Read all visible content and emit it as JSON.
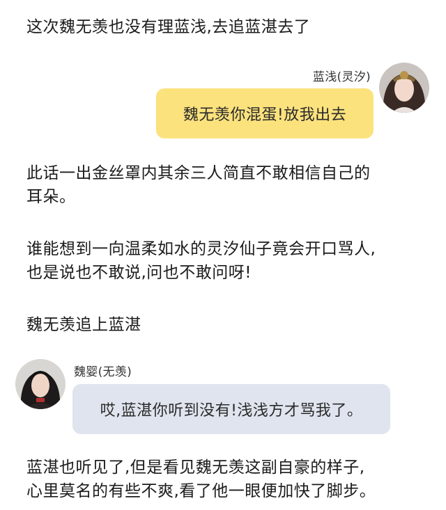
{
  "story": {
    "p1": "这次魏无羡也没有理蓝浅,去追蓝湛去了",
    "p2": "此话一出金丝罩内其余三人简直不敢相信自己的\n耳朵。",
    "p3": "谁能想到一向温柔如水的灵汐仙子竟会开口骂人,\n也是说也不敢说,问也不敢问呀!",
    "p4": "魏无羡追上蓝湛",
    "p5": "蓝湛也听见了,但是看见魏无羡这副自豪的样子,\n心里莫名的有些不爽,看了他一眼便加快了脚步。"
  },
  "chat": {
    "msg1": {
      "speaker": "蓝浅(灵汐)",
      "text": "魏无羡你混蛋!放我出去",
      "bubble_color": "#fbe27d",
      "avatar_icon": "female-character-avatar-icon"
    },
    "msg2": {
      "speaker": "魏婴(无羡)",
      "text": "哎,蓝湛你听到没有!浅浅方才骂我了。",
      "bubble_color": "#dfe4ee",
      "avatar_icon": "male-character-avatar-icon"
    }
  }
}
